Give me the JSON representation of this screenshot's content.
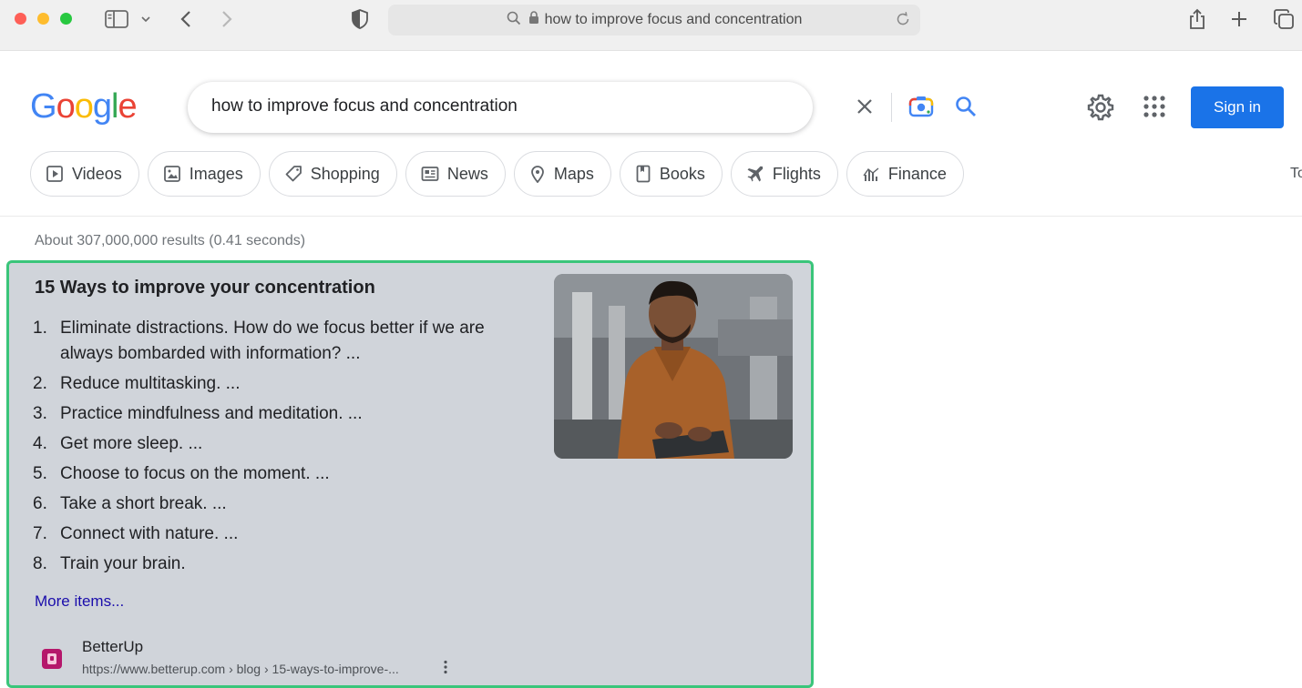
{
  "browser": {
    "url": "how to improve focus and concentration"
  },
  "header": {
    "logo": "Google",
    "query": "how to improve focus and concentration",
    "sign_in": "Sign in"
  },
  "tabs": [
    {
      "label": "Videos",
      "icon": "video-icon"
    },
    {
      "label": "Images",
      "icon": "image-icon"
    },
    {
      "label": "Shopping",
      "icon": "tag-icon"
    },
    {
      "label": "News",
      "icon": "news-icon"
    },
    {
      "label": "Maps",
      "icon": "pin-icon"
    },
    {
      "label": "Books",
      "icon": "book-icon"
    },
    {
      "label": "Flights",
      "icon": "plane-icon"
    },
    {
      "label": "Finance",
      "icon": "finance-icon"
    }
  ],
  "tools_label": "To",
  "results": {
    "stats": "About 307,000,000 results (0.41 seconds)"
  },
  "featured_snippet": {
    "title": "15 Ways to improve your concentration",
    "items": [
      {
        "num": "1.",
        "text": "Eliminate distractions. How do we focus better if we are always bombarded with information? ..."
      },
      {
        "num": "2.",
        "text": "Reduce multitasking. ..."
      },
      {
        "num": "3.",
        "text": "Practice mindfulness and meditation. ..."
      },
      {
        "num": "4.",
        "text": "Get more sleep. ..."
      },
      {
        "num": "5.",
        "text": "Choose to focus on the moment. ..."
      },
      {
        "num": "6.",
        "text": "Take a short break. ..."
      },
      {
        "num": "7.",
        "text": "Connect with nature. ..."
      },
      {
        "num": "8.",
        "text": "Train your brain."
      }
    ],
    "more_items": "More items...",
    "source_name": "BetterUp",
    "source_url": "https://www.betterup.com › blog › 15-ways-to-improve-...",
    "accent_color": "#3ac57a"
  }
}
